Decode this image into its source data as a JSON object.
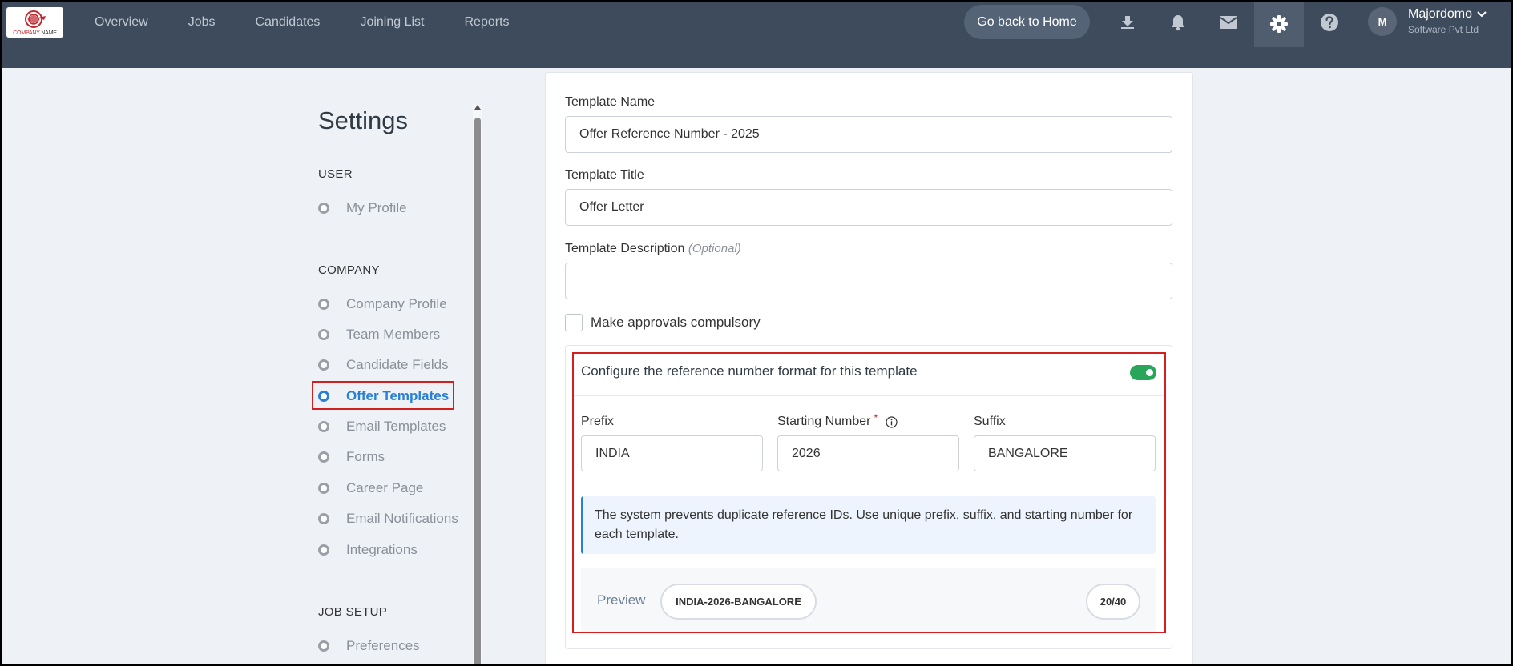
{
  "logo": {
    "text_main": "COMPANY",
    "text_sub": "NAME"
  },
  "nav": {
    "items": [
      "Overview",
      "Jobs",
      "Candidates",
      "Joining List",
      "Reports"
    ],
    "home_button": "Go back to Home"
  },
  "user": {
    "initial": "M",
    "name": "Majordomo",
    "company": "Software Pvt Ltd"
  },
  "sidebar": {
    "title": "Settings",
    "sections": [
      {
        "label": "USER",
        "items": [
          "My Profile"
        ]
      },
      {
        "label": "COMPANY",
        "items": [
          "Company Profile",
          "Team Members",
          "Candidate Fields",
          "Offer Templates",
          "Email Templates",
          "Forms",
          "Career Page",
          "Email Notifications",
          "Integrations"
        ]
      },
      {
        "label": "JOB SETUP",
        "items": [
          "Preferences"
        ]
      }
    ],
    "active_item": "Offer Templates"
  },
  "form": {
    "template_name_label": "Template Name",
    "template_name_value": "Offer Reference Number - 2025",
    "template_title_label": "Template Title",
    "template_title_value": "Offer Letter",
    "template_description_label": "Template Description",
    "template_description_optional": "(Optional)",
    "template_description_value": "",
    "approvals_label": "Make approvals compulsory"
  },
  "reference": {
    "title": "Configure the reference number format for this template",
    "enabled": true,
    "prefix_label": "Prefix",
    "prefix_value": "INDIA",
    "starting_label": "Starting Number",
    "required_mark": "*",
    "starting_value": "2026",
    "suffix_label": "Suffix",
    "suffix_value": "BANGALORE",
    "notice": "The system prevents duplicate reference IDs. Use unique prefix, suffix, and starting number for each template.",
    "preview_label": "Preview",
    "preview_value": "INDIA-2026-BANGALORE",
    "char_count": "20/40"
  },
  "colors": {
    "topbar": "#3d4b5c",
    "accent": "#2a7fd4",
    "toggle": "#2aa65a",
    "highlight": "#d12020"
  }
}
